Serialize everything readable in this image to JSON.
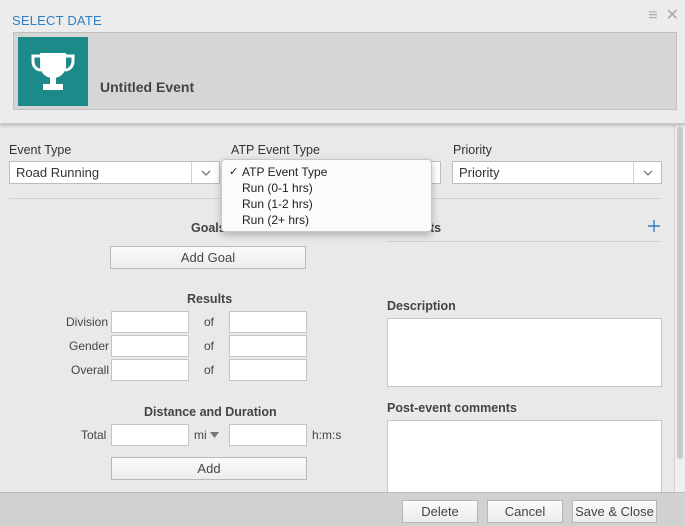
{
  "header": {
    "select_date": "SELECT DATE",
    "menu_icon": "menu-icon",
    "close_icon": "close-icon",
    "event_title": "Untitled Event",
    "trophy_icon": "trophy-icon",
    "accent_color": "#1d8a8a",
    "link_color": "#2f7fc6"
  },
  "fields": {
    "event_type": {
      "label": "Event Type",
      "value": "Road Running"
    },
    "atp_event_type": {
      "label": "ATP Event Type",
      "options": [
        {
          "label": "ATP Event Type",
          "checked": true
        },
        {
          "label": "Run (0-1 hrs)",
          "checked": false
        },
        {
          "label": "Run (1-2 hrs)",
          "checked": false
        },
        {
          "label": "Run (2+ hrs)",
          "checked": false
        }
      ]
    },
    "priority": {
      "label": "Priority",
      "value": "Priority"
    }
  },
  "goals": {
    "title": "Goals",
    "add_label": "Add Goal"
  },
  "right_section": {
    "title_partial": "ts",
    "add_icon": "plus-icon"
  },
  "results": {
    "title": "Results",
    "rows": [
      {
        "label": "Division",
        "of": "of"
      },
      {
        "label": "Gender",
        "of": "of"
      },
      {
        "label": "Overall",
        "of": "of"
      }
    ]
  },
  "distance": {
    "title": "Distance and Duration",
    "total_label": "Total",
    "unit": "mi",
    "time_unit": "h:m:s",
    "add_label": "Add"
  },
  "description": {
    "label": "Description"
  },
  "post_event": {
    "label": "Post-event comments"
  },
  "footer": {
    "delete": "Delete",
    "cancel": "Cancel",
    "save_close": "Save & Close"
  }
}
